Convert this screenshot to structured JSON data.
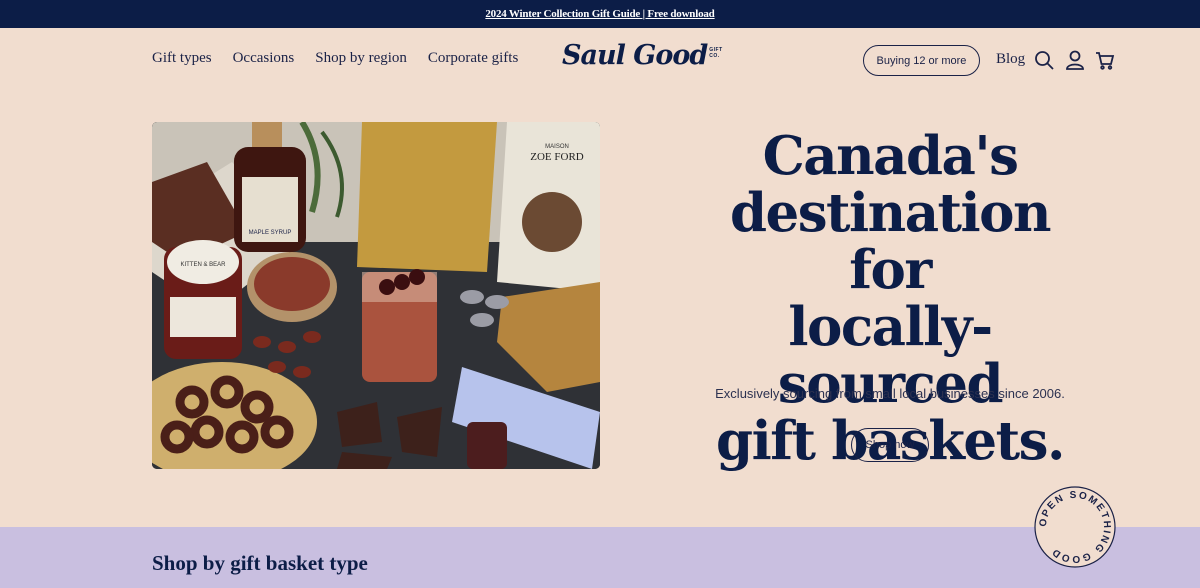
{
  "announcement": {
    "text": "2024 Winter Collection Gift Guide | Free download"
  },
  "nav": {
    "items": [
      "Gift types",
      "Occasions",
      "Shop by region",
      "Corporate gifts"
    ]
  },
  "logo": {
    "wordmark": "Saul Good",
    "sub_line1": "GIFT",
    "sub_line2": "CO."
  },
  "header_actions": {
    "bulk_label": "Buying 12 or more",
    "blog_label": "Blog",
    "icons": [
      "search-icon",
      "account-icon",
      "cart-icon"
    ]
  },
  "hero": {
    "title_lines": [
      "Canada's",
      "destination for",
      "locally-sourced",
      "gift baskets."
    ],
    "subtitle": "Exclusively sourcing from small local businesses since 2006.",
    "cta_label": "Shop now",
    "image_labels": {
      "syrup": "MAPLE SYRUP",
      "jar": "KITTEN & BEAR",
      "brand": "ZOE FORD",
      "maison": "MAISON"
    }
  },
  "badge": {
    "text": "OPEN SOMETHING GOOD"
  },
  "section": {
    "title": "Shop by gift basket type"
  },
  "colors": {
    "nav_dark": "#0c1d47",
    "bg_peach": "#f1ddcf",
    "section_lavender": "#c9bfe0"
  }
}
